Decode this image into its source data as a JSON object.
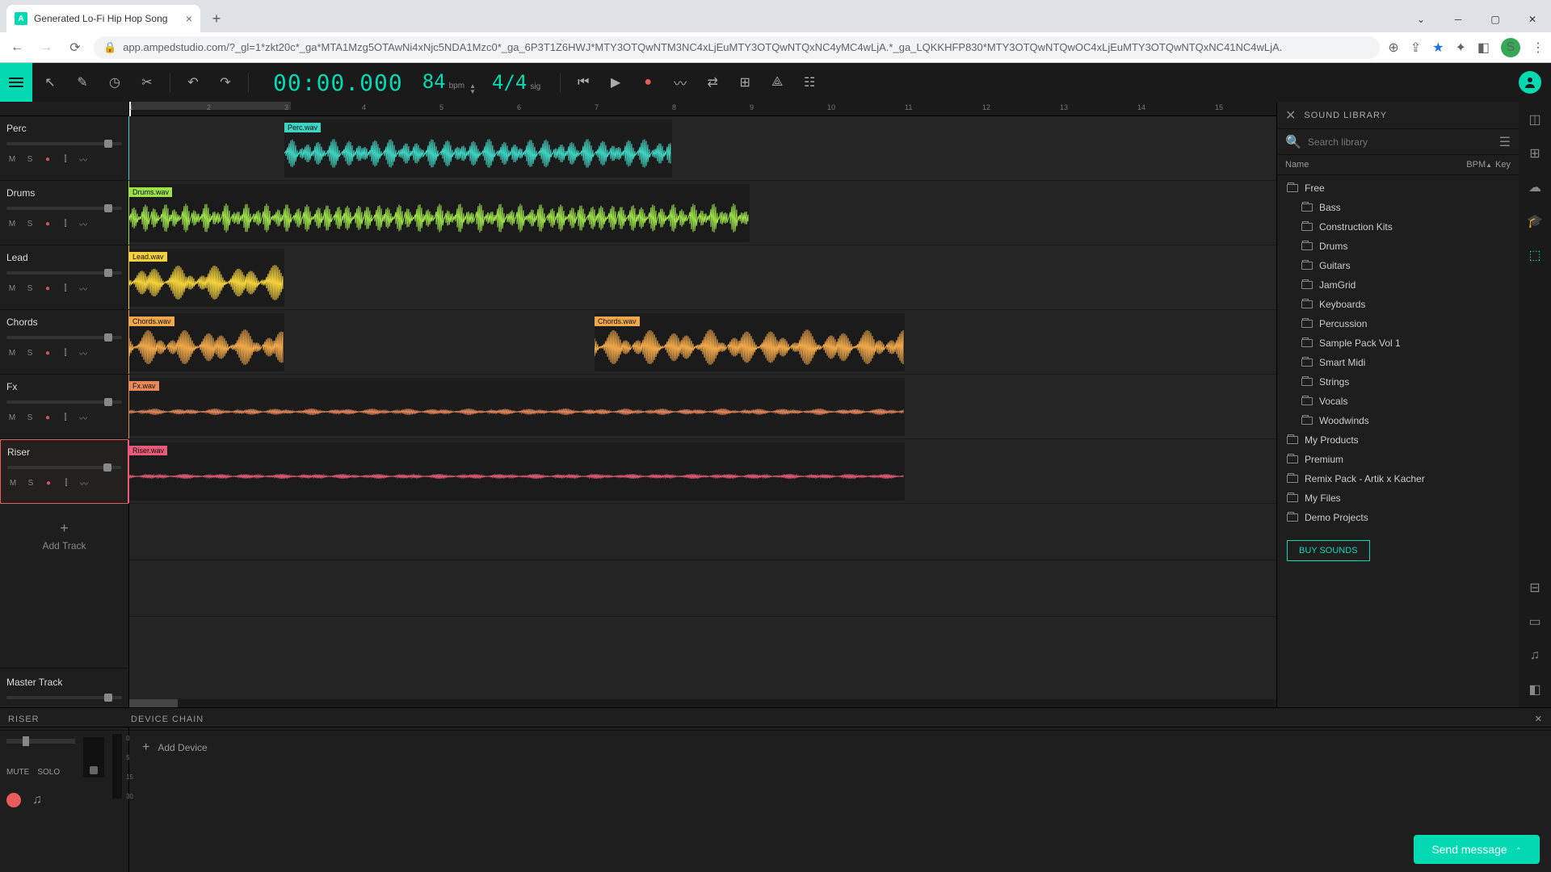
{
  "browser": {
    "tab_title": "Generated Lo-Fi Hip Hop Song",
    "url": "app.ampedstudio.com/?_gl=1*zkt20c*_ga*MTA1Mzg5OTAwNi4xNjc5NDA1Mzc0*_ga_6P3T1Z6HWJ*MTY3OTQwNTM3NC4xLjEuMTY3OTQwNTQxNC4yMC4wLjA.*_ga_LQKKHFP830*MTY3OTQwNTQwOC4xLjEuMTY3OTQwNTQxNC41NC4wLjA."
  },
  "transport": {
    "time": "00:00.000",
    "bpm": "84",
    "bpm_label": "bpm",
    "sig": "4/4",
    "sig_label": "sig"
  },
  "ruler_marks": [
    "1",
    "2",
    "3",
    "4",
    "5",
    "6",
    "7",
    "8",
    "9",
    "10",
    "11",
    "12",
    "13",
    "14",
    "15"
  ],
  "tracks": [
    {
      "name": "Perc",
      "color": "#3fd4c2",
      "clip": "Perc.wav",
      "controls": [
        "M",
        "S"
      ]
    },
    {
      "name": "Drums",
      "color": "#9de04a",
      "clip": "Drums.wav",
      "controls": [
        "M",
        "S"
      ]
    },
    {
      "name": "Lead",
      "color": "#f5d23b",
      "clip": "Lead.wav",
      "controls": [
        "M",
        "S"
      ]
    },
    {
      "name": "Chords",
      "color": "#f0a84a",
      "clip": "Chords.wav",
      "controls": [
        "M",
        "S"
      ]
    },
    {
      "name": "Fx",
      "color": "#e8895c",
      "clip": "Fx.wav",
      "controls": [
        "M",
        "S"
      ]
    },
    {
      "name": "Riser",
      "color": "#e85c7a",
      "clip": "Riser.wav",
      "controls": [
        "M",
        "S"
      ],
      "selected": true
    }
  ],
  "add_track_label": "Add Track",
  "master_label": "Master Track",
  "library": {
    "title": "SOUND LIBRARY",
    "search_placeholder": "Search library",
    "col_name": "Name",
    "col_bpm": "BPM",
    "col_key": "Key",
    "tree": [
      {
        "label": "Free",
        "level": 0
      },
      {
        "label": "Bass",
        "level": 1
      },
      {
        "label": "Construction Kits",
        "level": 1
      },
      {
        "label": "Drums",
        "level": 1
      },
      {
        "label": "Guitars",
        "level": 1
      },
      {
        "label": "JamGrid",
        "level": 1
      },
      {
        "label": "Keyboards",
        "level": 1
      },
      {
        "label": "Percussion",
        "level": 1
      },
      {
        "label": "Sample Pack Vol 1",
        "level": 1
      },
      {
        "label": "Smart Midi",
        "level": 1
      },
      {
        "label": "Strings",
        "level": 1
      },
      {
        "label": "Vocals",
        "level": 1
      },
      {
        "label": "Woodwinds",
        "level": 1
      },
      {
        "label": "My Products",
        "level": 0
      },
      {
        "label": "Premium",
        "level": 0
      },
      {
        "label": "Remix Pack - Artik x Kacher",
        "level": 0
      },
      {
        "label": "My Files",
        "level": 0
      },
      {
        "label": "Demo Projects",
        "level": 0
      }
    ],
    "buy_label": "BUY SOUNDS"
  },
  "dock": {
    "track_title": "RISER",
    "chain_title": "DEVICE CHAIN",
    "mute": "MUTE",
    "solo": "SOLO",
    "add_device": "Add Device"
  },
  "send_msg": "Send message",
  "chart_data": {
    "type": "timeline",
    "bpm": 84,
    "time_signature": "4/4",
    "bars_visible": 15,
    "clips": [
      {
        "track": "Perc",
        "file": "Perc.wav",
        "start_bar": 3.0,
        "end_bar": 8.0
      },
      {
        "track": "Drums",
        "file": "Drums.wav",
        "start_bar": 1.0,
        "end_bar": 9.0
      },
      {
        "track": "Lead",
        "file": "Lead.wav",
        "start_bar": 1.0,
        "end_bar": 3.0
      },
      {
        "track": "Chords",
        "file": "Chords.wav",
        "start_bar": 1.0,
        "end_bar": 3.0
      },
      {
        "track": "Chords",
        "file": "Chords.wav",
        "start_bar": 7.0,
        "end_bar": 11.0
      },
      {
        "track": "Fx",
        "file": "Fx.wav",
        "start_bar": 1.0,
        "end_bar": 11.0
      },
      {
        "track": "Riser",
        "file": "Riser.wav",
        "start_bar": 1.0,
        "end_bar": 11.0
      }
    ]
  }
}
